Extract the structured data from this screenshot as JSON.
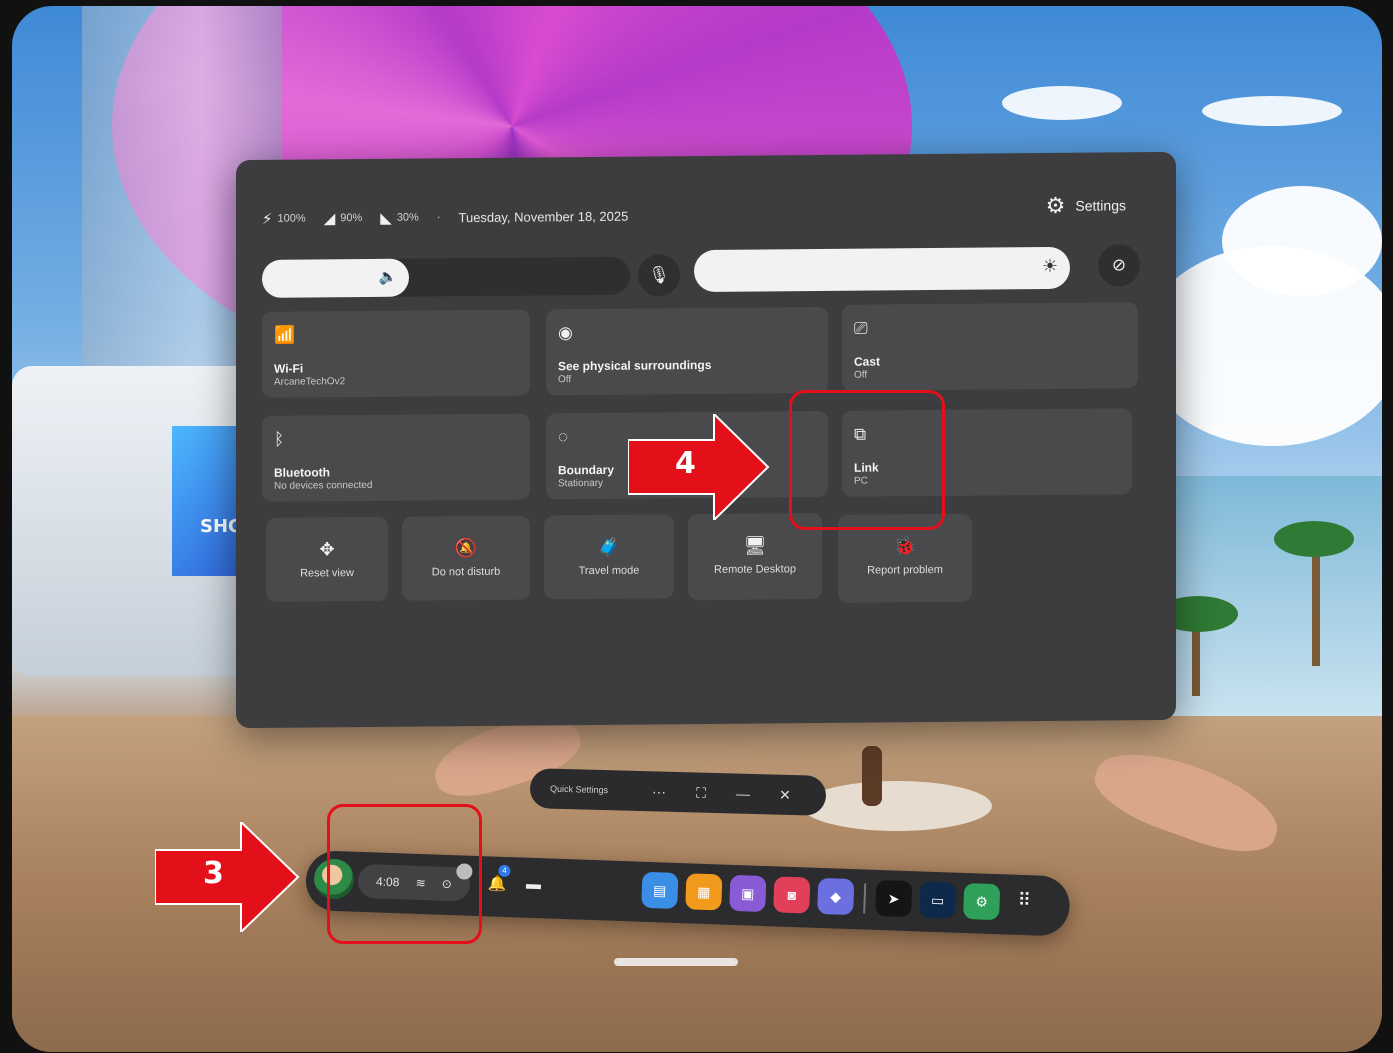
{
  "status": {
    "headset_battery": "100%",
    "right_controller_battery": "90%",
    "left_controller_battery": "30%",
    "separator": "·",
    "date": "Tuesday, November 18, 2025"
  },
  "settings_label": "Settings",
  "sliders": {
    "volume_level": 0.4,
    "brightness_level": 1.0
  },
  "tiles": [
    {
      "title": "Wi-Fi",
      "subtitle": "ArcaneTechOv2",
      "icon": "wifi-icon"
    },
    {
      "title": "See physical surroundings",
      "subtitle": "Off",
      "icon": "eye-icon"
    },
    {
      "title": "Cast",
      "subtitle": "Off",
      "icon": "cast-icon"
    },
    {
      "title": "Bluetooth",
      "subtitle": "No devices connected",
      "icon": "bluetooth-icon"
    },
    {
      "title": "Boundary",
      "subtitle": "Stationary",
      "icon": "boundary-icon"
    },
    {
      "title": "Link",
      "subtitle": "PC",
      "icon": "link-icon"
    }
  ],
  "small_tiles": [
    {
      "label": "Reset view",
      "icon": "move-icon"
    },
    {
      "label": "Do not disturb",
      "icon": "bell-off-icon"
    },
    {
      "label": "Travel mode",
      "icon": "travel-icon"
    },
    {
      "label": "Remote Desktop",
      "icon": "monitor-icon"
    },
    {
      "label": "Report problem",
      "icon": "bug-icon"
    }
  ],
  "window_bar": {
    "title": "Quick Settings",
    "more": "···",
    "expand": "⛶",
    "minimize": "—",
    "close": "✕"
  },
  "taskbar": {
    "time": "4:08",
    "notification_count": "4",
    "apps": [
      {
        "name": "app-1",
        "color": "#3a8ee6"
      },
      {
        "name": "app-2",
        "color": "#f29a1c"
      },
      {
        "name": "app-3",
        "color": "#8a5bd6"
      },
      {
        "name": "app-4",
        "color": "#e0405a"
      },
      {
        "name": "app-5",
        "color": "#6b6fe0"
      },
      {
        "name": "app-6",
        "color": "#151515"
      },
      {
        "name": "app-7",
        "color": "#0e2a4a"
      },
      {
        "name": "app-8",
        "color": "#2fa05a"
      }
    ]
  },
  "annotations": {
    "label_3": "3",
    "label_4": "4",
    "annotation_color": "#e3101a"
  }
}
